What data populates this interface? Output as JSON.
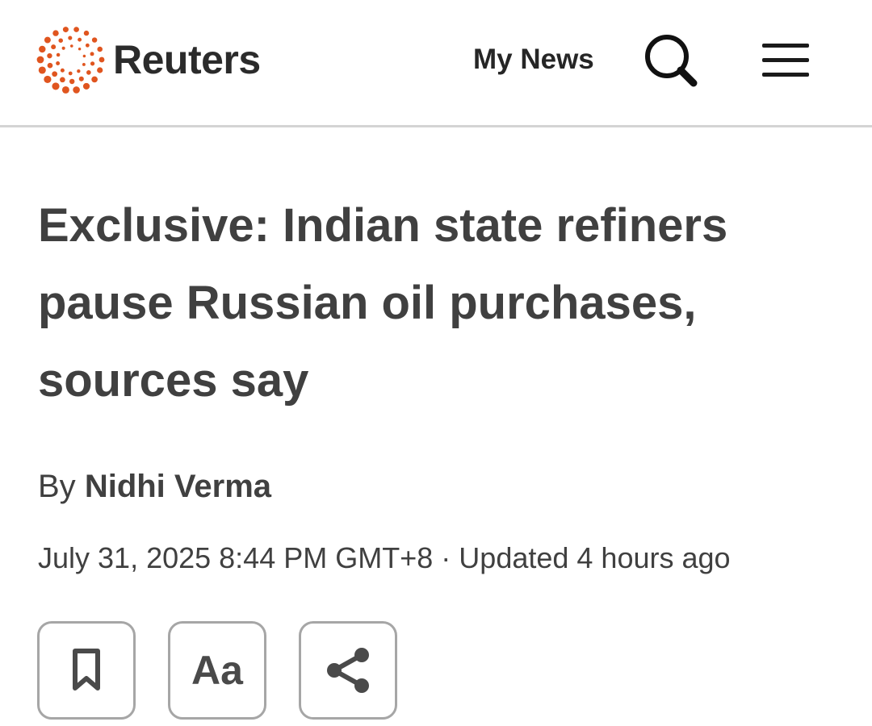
{
  "header": {
    "brand": "Reuters",
    "my_news_label": "My News",
    "search_icon": "search-icon",
    "menu_icon": "hamburger-menu-icon",
    "brand_color": "#e0551f"
  },
  "article": {
    "headline": "Exclusive: Indian state refiners pause Russian oil purchases, sources say",
    "byline_prefix": "By",
    "author": "Nidhi Verma",
    "published": "July 31, 2025 8:44 PM GMT+8",
    "separator": "·",
    "updated": "Updated 4 hours ago"
  },
  "tools": [
    {
      "name": "bookmark",
      "icon": "bookmark-icon"
    },
    {
      "name": "text-size",
      "label": "Aa"
    },
    {
      "name": "share",
      "icon": "share-icon"
    }
  ]
}
